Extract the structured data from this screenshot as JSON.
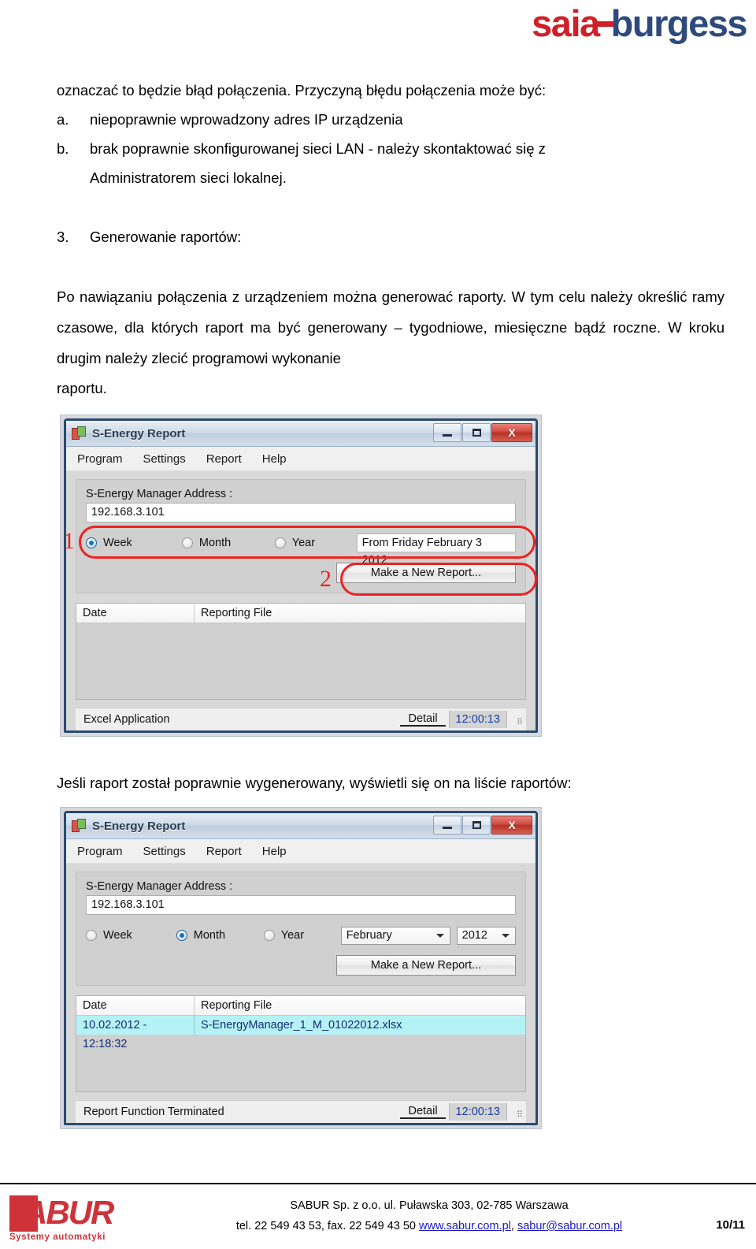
{
  "header": {
    "brand_first": "saia",
    "brand_second": "burgess"
  },
  "document": {
    "intro_paragraph": "oznaczać to będzie błąd połączenia. Przyczyną błędu połączenia może być:",
    "causes": [
      {
        "marker": "a.",
        "text": "niepoprawnie wprowadzony adres IP urządzenia"
      },
      {
        "marker": "b.",
        "text": "brak poprawnie skonfigurowanej sieci LAN - należy skontaktować się z",
        "text2": "Administratorem sieci lokalnej."
      }
    ],
    "section": {
      "marker": "3.",
      "title": "Generowanie raportów:"
    },
    "body_main": "Po nawiązaniu połączenia z urządzeniem można generować raporty. W tym celu należy określić ramy czasowe, dla których raport ma być generowany – tygodniowe, miesięczne bądź roczne. W kroku drugim należy zlecić programowi wykonanie",
    "body_main_last": "raportu.",
    "caption_between": "Jeśli raport został poprawnie wygenerowany, wyświetli się on na liście raportów:"
  },
  "window1": {
    "title": "S-Energy Report",
    "icon": "report-app-icon",
    "buttons": {
      "minimize": "minimize-icon",
      "maximize": "maximize-icon",
      "close": "X"
    },
    "menu": [
      "Program",
      "Settings",
      "Report",
      "Help"
    ],
    "address_label": "S-Energy Manager Address :",
    "address_value": "192.168.3.101",
    "radios": [
      {
        "label": "Week",
        "selected": true
      },
      {
        "label": "Month",
        "selected": false
      },
      {
        "label": "Year",
        "selected": false
      }
    ],
    "date_value": "From Friday February 3 2012",
    "make_report_button": "Make a New Report...",
    "list_columns": [
      "Date",
      "Reporting File"
    ],
    "list_rows": [],
    "status_text": "Excel Application",
    "status_detail": "Detail",
    "status_time": "12:00:13",
    "annotations": [
      {
        "number": "1"
      },
      {
        "number": "2"
      }
    ]
  },
  "window2": {
    "title": "S-Energy Report",
    "icon": "report-app-icon",
    "buttons": {
      "minimize": "minimize-icon",
      "maximize": "maximize-icon",
      "close": "X"
    },
    "menu": [
      "Program",
      "Settings",
      "Report",
      "Help"
    ],
    "address_label": "S-Energy Manager Address :",
    "address_value": "192.168.3.101",
    "radios": [
      {
        "label": "Week",
        "selected": false
      },
      {
        "label": "Month",
        "selected": true
      },
      {
        "label": "Year",
        "selected": false
      }
    ],
    "month_combo": "February",
    "year_combo": "2012",
    "make_report_button": "Make a New Report...",
    "list_columns": [
      "Date",
      "Reporting File"
    ],
    "list_rows": [
      {
        "date": "10.02.2012 - 12:18:32",
        "file": "S-EnergyManager_1_M_01022012.xlsx"
      }
    ],
    "status_text": "Report Function Terminated",
    "status_detail": "Detail",
    "status_time": "12:00:13"
  },
  "footer": {
    "logo_word": "ABUR",
    "logo_tagline": "Systemy automatyki",
    "line1": "SABUR Sp. z o.o.  ul. Puławska 303, 02-785 Warszawa",
    "line2_a": "tel. 22 549 43 53, fax. 22 549 43 50  ",
    "line2_link1": "www.sabur.com.pl",
    "line2_sep": ", ",
    "line2_link2": "sabur@sabur.com.pl",
    "page": "10/11"
  },
  "colors": {
    "brand_red": "#cf2027",
    "brand_blue": "#2e4a7d",
    "annotation_red": "#ee2222",
    "selection_cyan": "#b5f2f5",
    "link_blue": "#1a18c4"
  }
}
